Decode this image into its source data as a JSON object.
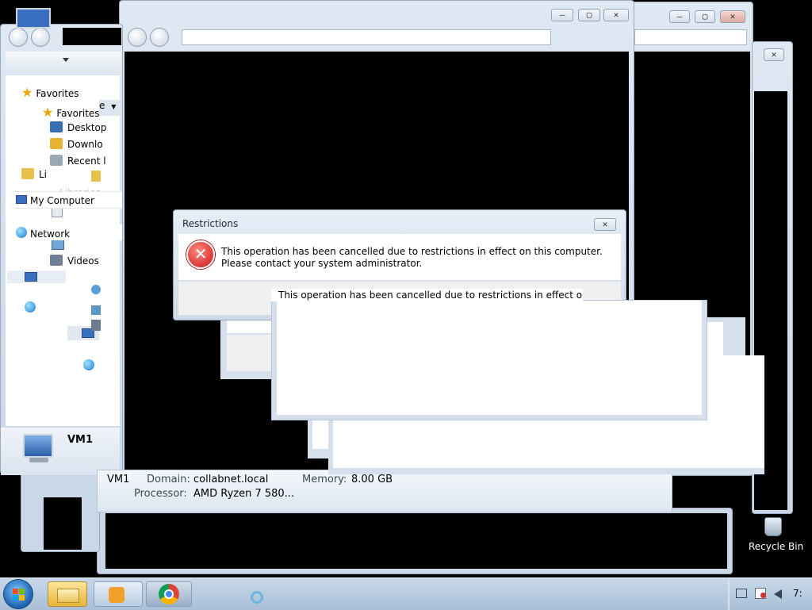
{
  "explorer": {
    "favorites_header": "Favorites",
    "favorites_sub": "Favorites",
    "desktop": "Desktop",
    "downloads": "Downlo",
    "recent": "Recent l",
    "libraries_short": "Li",
    "libraries_ghost": "Libraries",
    "my_computer": "My Computer",
    "network": "Network",
    "videos": "Videos",
    "computer_name": "VM1",
    "partial_dropdown_text": "e"
  },
  "details": {
    "vm_name": "VM1",
    "domain_label": "Domain:",
    "domain_value": "collabnet.local",
    "memory_label": "Memory:",
    "memory_value": "8.00 GB",
    "processor_label": "Processor:",
    "processor_value": "AMD Ryzen 7 580..."
  },
  "dialog": {
    "title": "Restrictions",
    "message": "This operation has been cancelled due to restrictions in effect on this computer. Please contact your system administrator.",
    "ghost_message": "This operation has been cancelled due to restrictions in effect on this"
  },
  "desktop": {
    "recycle_bin": "Recycle Bin"
  },
  "taskbar": {
    "clock_partial": "7:"
  },
  "window_buttons": {
    "minimize": "–",
    "maximize": "▢",
    "close": "✕"
  }
}
